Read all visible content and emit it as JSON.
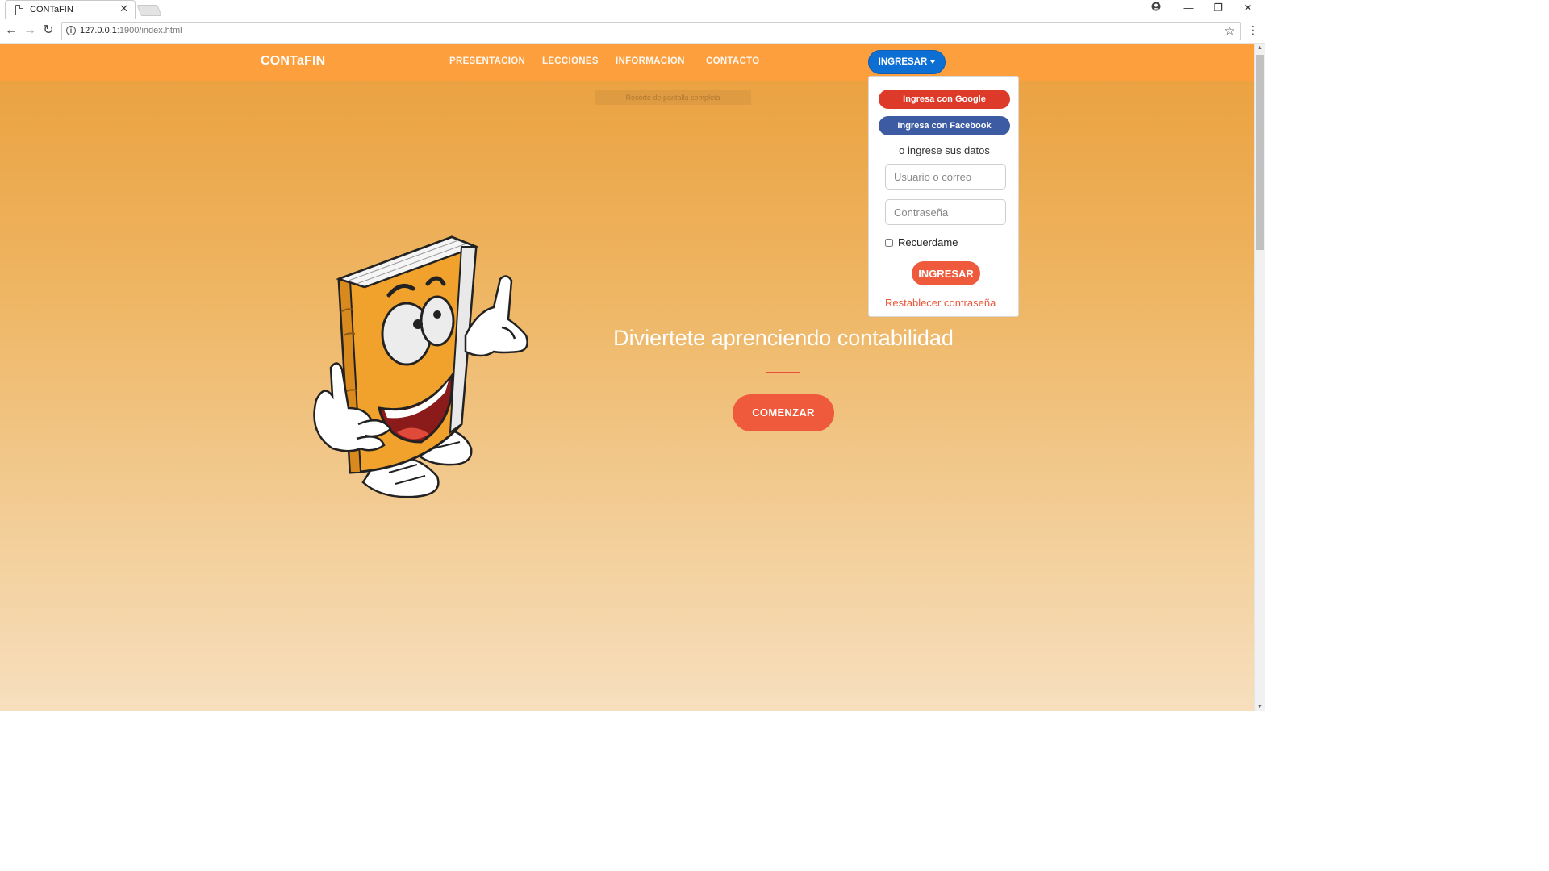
{
  "browser": {
    "tab_title": "CONTaFIN",
    "url_host": "127.0.0.1",
    "url_path": ":1900/index.html",
    "window_controls": {
      "account": "●",
      "minimize": "—",
      "restore": "❐",
      "close": "✕"
    }
  },
  "navbar": {
    "brand": "CONTaFIN",
    "links": [
      "PRESENTACIÓN",
      "LECCIONES",
      "INFORMACION",
      "CONTACTO"
    ],
    "login_button": "INGRESAR",
    "ghost_tooltip": "Recorte de pantalla completa"
  },
  "login_dropdown": {
    "google_button": "Ingresa con Google",
    "facebook_button": "Ingresa con Facebook",
    "or_text": "o ingrese sus datos",
    "username_placeholder": "Usuario o correo",
    "password_placeholder": "Contraseña",
    "remember_label": "Recuerdame",
    "submit_button": "INGRESAR",
    "reset_link": "Restablecer contraseña"
  },
  "hero": {
    "title": "Diviertete aprenciendo contabilidad",
    "cta_button": "COMENZAR"
  },
  "colors": {
    "navbar": "#fe9f3e",
    "accent": "#ef5a3c",
    "login_blue": "#0d6fd4",
    "google_red": "#dd3a2a",
    "facebook_blue": "#3c5ba3",
    "book_orange": "#f0a22d"
  }
}
